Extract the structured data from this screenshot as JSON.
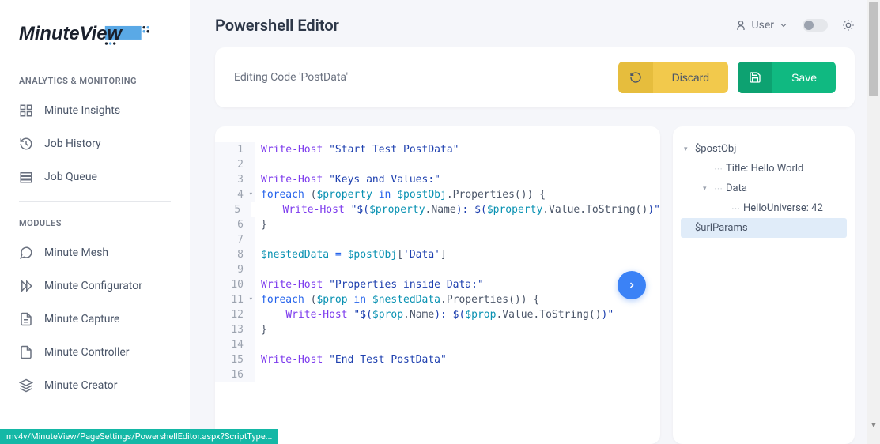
{
  "brand": "MinuteView",
  "header": {
    "title": "Powershell Editor",
    "user_label": "User"
  },
  "sidebar": {
    "section_analytics": "ANALYTICS & MONITORING",
    "section_modules": "MODULES",
    "items": {
      "insights": "Minute Insights",
      "job_history": "Job History",
      "job_queue": "Job Queue",
      "mesh": "Minute Mesh",
      "configurator": "Minute Configurator",
      "capture": "Minute Capture",
      "controller": "Minute Controller",
      "creator": "Minute Creator"
    }
  },
  "toolbar": {
    "editing_label": "Editing Code 'PostData'",
    "discard_label": "Discard",
    "save_label": "Save"
  },
  "code": {
    "lines": [
      {
        "num": "1",
        "tokens": [
          {
            "t": "Write-Host",
            "c": "cmd"
          },
          {
            "t": " ",
            "c": ""
          },
          {
            "t": "\"Start Test PostData\"",
            "c": "str"
          }
        ]
      },
      {
        "num": "2",
        "tokens": []
      },
      {
        "num": "3",
        "tokens": [
          {
            "t": "Write-Host",
            "c": "cmd"
          },
          {
            "t": " ",
            "c": ""
          },
          {
            "t": "\"Keys and Values:\"",
            "c": "str"
          }
        ]
      },
      {
        "num": "4",
        "fold": true,
        "tokens": [
          {
            "t": "foreach",
            "c": "kw"
          },
          {
            "t": " (",
            "c": "punct"
          },
          {
            "t": "$property",
            "c": "var"
          },
          {
            "t": " ",
            "c": ""
          },
          {
            "t": "in",
            "c": "kw"
          },
          {
            "t": " ",
            "c": ""
          },
          {
            "t": "$postObj",
            "c": "var"
          },
          {
            "t": ".Properties()) {",
            "c": "punct"
          }
        ]
      },
      {
        "num": "5",
        "tokens": [
          {
            "t": "    ",
            "c": ""
          },
          {
            "t": "Write-Host",
            "c": "cmd"
          },
          {
            "t": " ",
            "c": ""
          },
          {
            "t": "\"$(",
            "c": "str"
          },
          {
            "t": "$property",
            "c": "var"
          },
          {
            "t": ".Name",
            "c": "punct"
          },
          {
            "t": "): $(",
            "c": "str"
          },
          {
            "t": "$property",
            "c": "var"
          },
          {
            "t": ".Value.ToString()",
            "c": "punct"
          },
          {
            "t": ")\"",
            "c": "str"
          }
        ]
      },
      {
        "num": "6",
        "tokens": [
          {
            "t": "}",
            "c": "punct"
          }
        ]
      },
      {
        "num": "7",
        "tokens": []
      },
      {
        "num": "8",
        "tokens": [
          {
            "t": "$nestedData",
            "c": "var"
          },
          {
            "t": " = ",
            "c": "op"
          },
          {
            "t": "$postObj",
            "c": "var"
          },
          {
            "t": "[",
            "c": "punct"
          },
          {
            "t": "'Data'",
            "c": "str"
          },
          {
            "t": "]",
            "c": "punct"
          }
        ]
      },
      {
        "num": "9",
        "tokens": []
      },
      {
        "num": "10",
        "tokens": [
          {
            "t": "Write-Host",
            "c": "cmd"
          },
          {
            "t": " ",
            "c": ""
          },
          {
            "t": "\"Properties inside Data:\"",
            "c": "str"
          }
        ]
      },
      {
        "num": "11",
        "fold": true,
        "tokens": [
          {
            "t": "foreach",
            "c": "kw"
          },
          {
            "t": " (",
            "c": "punct"
          },
          {
            "t": "$prop",
            "c": "var"
          },
          {
            "t": " ",
            "c": ""
          },
          {
            "t": "in",
            "c": "kw"
          },
          {
            "t": " ",
            "c": ""
          },
          {
            "t": "$nestedData",
            "c": "var"
          },
          {
            "t": ".Properties()) {",
            "c": "punct"
          }
        ]
      },
      {
        "num": "12",
        "tokens": [
          {
            "t": "    ",
            "c": ""
          },
          {
            "t": "Write-Host",
            "c": "cmd"
          },
          {
            "t": " ",
            "c": ""
          },
          {
            "t": "\"$(",
            "c": "str"
          },
          {
            "t": "$prop",
            "c": "var"
          },
          {
            "t": ".Name",
            "c": "punct"
          },
          {
            "t": "): $(",
            "c": "str"
          },
          {
            "t": "$prop",
            "c": "var"
          },
          {
            "t": ".Value.ToString()",
            "c": "punct"
          },
          {
            "t": ")\"",
            "c": "str"
          }
        ]
      },
      {
        "num": "13",
        "tokens": [
          {
            "t": "}",
            "c": "punct"
          }
        ]
      },
      {
        "num": "14",
        "tokens": []
      },
      {
        "num": "15",
        "tokens": [
          {
            "t": "Write-Host",
            "c": "cmd"
          },
          {
            "t": " ",
            "c": ""
          },
          {
            "t": "\"End Test PostData\"",
            "c": "str"
          }
        ]
      },
      {
        "num": "16",
        "tokens": []
      }
    ]
  },
  "tree": {
    "items": [
      {
        "label": "$postObj",
        "indent": 0,
        "toggle": true
      },
      {
        "label": "Title: Hello World",
        "indent": 1
      },
      {
        "label": "Data",
        "indent": 1,
        "toggle": true
      },
      {
        "label": "HelloUniverse: 42",
        "indent": 2
      },
      {
        "label": "$urlParams",
        "indent": 0,
        "selected": true
      }
    ]
  },
  "status_bar": "mv4v/MinuteView/PageSettings/PowershellEditor.aspx?ScriptType..."
}
